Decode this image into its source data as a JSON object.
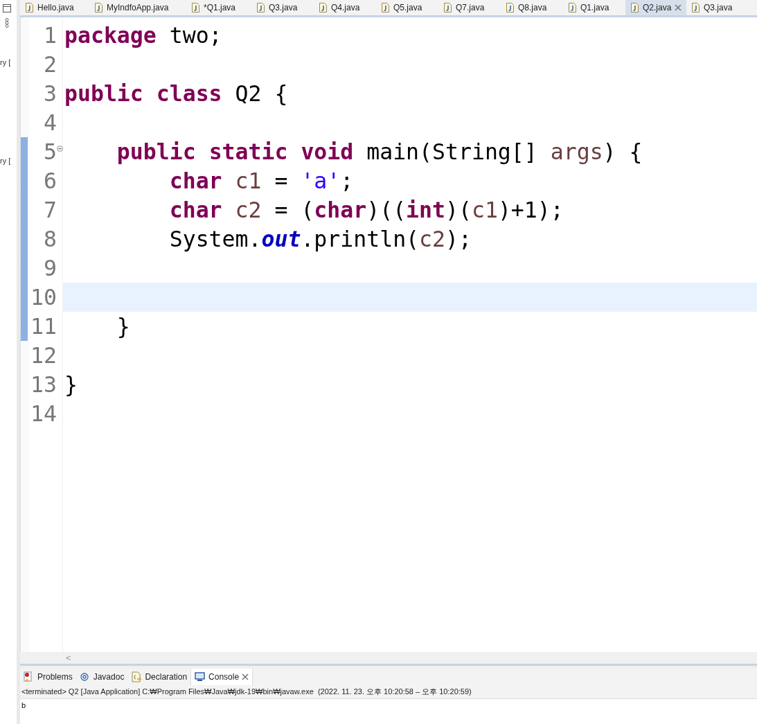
{
  "side_panel": {
    "texts": [
      "ry [",
      "ry ["
    ]
  },
  "editor_tabs": [
    {
      "label": "Hello.java",
      "selected": false
    },
    {
      "label": "MyIndfoApp.java",
      "selected": false
    },
    {
      "label": "*Q1.java",
      "selected": false
    },
    {
      "label": "Q3.java",
      "selected": false
    },
    {
      "label": "Q4.java",
      "selected": false
    },
    {
      "label": "Q5.java",
      "selected": false
    },
    {
      "label": "Q7.java",
      "selected": false
    },
    {
      "label": "Q8.java",
      "selected": false
    },
    {
      "label": "Q1.java",
      "selected": false
    },
    {
      "label": "Q2.java",
      "selected": true
    },
    {
      "label": "Q3.java",
      "selected": false
    }
  ],
  "editor": {
    "lines": [
      {
        "number": "1",
        "current": false,
        "changed": false,
        "fold": false,
        "tokens": [
          {
            "kind": "keyword",
            "text": "package"
          },
          {
            "kind": "plain",
            "text": " two;"
          }
        ]
      },
      {
        "number": "2",
        "current": false,
        "changed": false,
        "fold": false
      },
      {
        "number": "3",
        "current": false,
        "changed": false,
        "fold": false,
        "tokens": [
          {
            "kind": "keyword",
            "text": "public "
          },
          {
            "kind": "keyword",
            "text": "class"
          },
          {
            "kind": "plain",
            "text": " Q2 {"
          }
        ]
      },
      {
        "number": "4",
        "current": false,
        "changed": false,
        "fold": false
      },
      {
        "number": "5",
        "current": false,
        "changed": true,
        "fold": true,
        "tokens": [
          {
            "kind": "keyword",
            "text": "    public "
          },
          {
            "kind": "keyword",
            "text": "static "
          },
          {
            "kind": "keyword",
            "text": "void"
          },
          {
            "kind": "plain",
            "text": " main(String[] "
          },
          {
            "kind": "variable",
            "text": "args"
          },
          {
            "kind": "plain",
            "text": ") {"
          }
        ]
      },
      {
        "number": "6",
        "current": false,
        "changed": true,
        "fold": false,
        "tokens": [
          {
            "kind": "keyword",
            "text": "        char "
          },
          {
            "kind": "variable",
            "text": "c1"
          },
          {
            "kind": "plain",
            "text": " = "
          },
          {
            "kind": "string",
            "text": "'a'"
          },
          {
            "kind": "plain",
            "text": ";"
          }
        ]
      },
      {
        "number": "7",
        "current": false,
        "changed": true,
        "fold": false,
        "tokens": [
          {
            "kind": "keyword",
            "text": "        char "
          },
          {
            "kind": "variable",
            "text": "c2"
          },
          {
            "kind": "plain",
            "text": " = ("
          },
          {
            "kind": "keyword",
            "text": "char"
          },
          {
            "kind": "plain",
            "text": ")(("
          },
          {
            "kind": "keyword",
            "text": "int"
          },
          {
            "kind": "plain",
            "text": ")("
          },
          {
            "kind": "variable",
            "text": "c1"
          },
          {
            "kind": "plain",
            "text": ")+1);"
          }
        ]
      },
      {
        "number": "8",
        "current": false,
        "changed": true,
        "fold": false,
        "tokens": [
          {
            "kind": "plain",
            "text": "        System."
          },
          {
            "kind": "field",
            "text": "out"
          },
          {
            "kind": "plain",
            "text": ".println("
          },
          {
            "kind": "variable",
            "text": "c2"
          },
          {
            "kind": "plain",
            "text": ");"
          }
        ]
      },
      {
        "number": "9",
        "current": false,
        "changed": true,
        "fold": false
      },
      {
        "number": "10",
        "current": true,
        "changed": true,
        "fold": false
      },
      {
        "number": "11",
        "current": false,
        "changed": true,
        "fold": false,
        "tokens": [
          {
            "kind": "plain",
            "text": "    }"
          }
        ]
      },
      {
        "number": "12",
        "current": false,
        "changed": false,
        "fold": false
      },
      {
        "number": "13",
        "current": false,
        "changed": false,
        "fold": false,
        "tokens": [
          {
            "kind": "plain",
            "text": "}"
          }
        ]
      },
      {
        "number": "14",
        "current": false,
        "changed": false,
        "fold": false
      }
    ]
  },
  "scrollbar": {
    "arrow": "<"
  },
  "bottom_panel": {
    "tabs": [
      {
        "label": "Problems",
        "kind": "problems",
        "selected": false
      },
      {
        "label": "Javadoc",
        "kind": "javadoc",
        "selected": false
      },
      {
        "label": "Declaration",
        "kind": "declaration",
        "selected": false
      },
      {
        "label": "Console",
        "kind": "console",
        "selected": true
      }
    ],
    "console_header": "<terminated> Q2 [Java Application] C:₩Program Files₩Java₩jdk-19₩bin₩javaw.exe  (2022. 11. 23. 오후 10:20:58 – 오후 10:20:59)",
    "output": "b"
  }
}
